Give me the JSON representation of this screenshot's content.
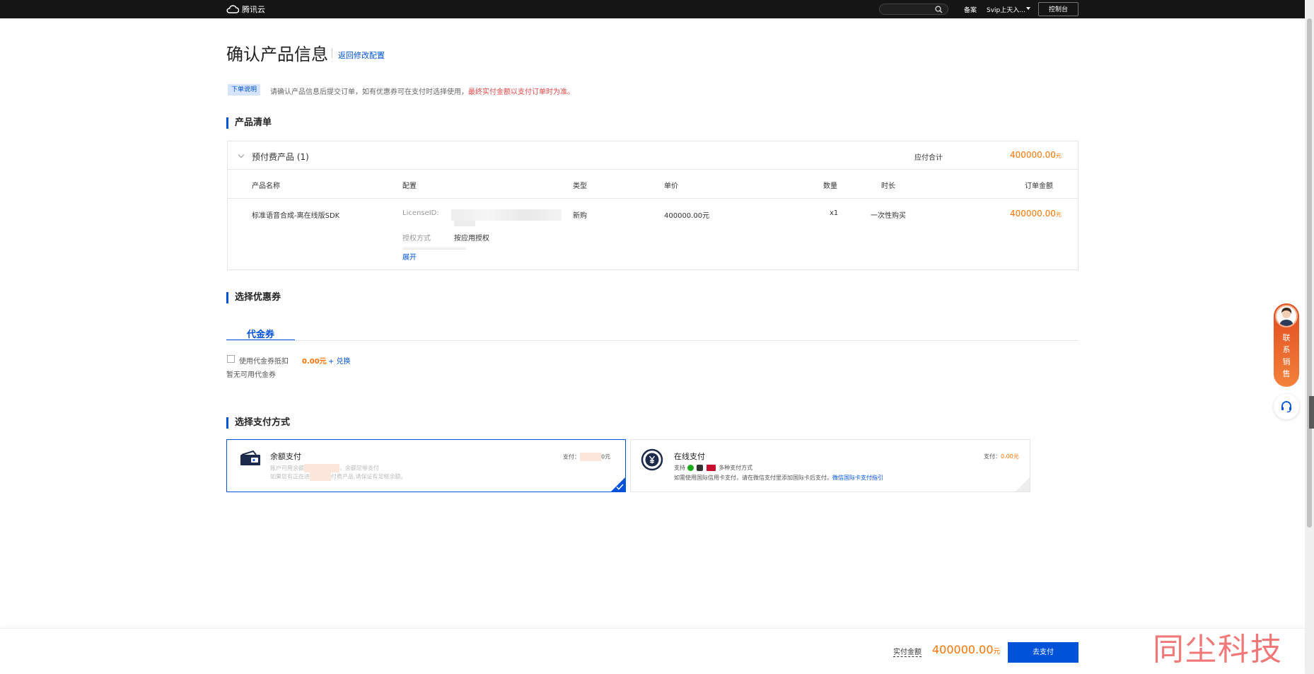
{
  "topbar": {
    "brand": "腾讯云",
    "beian": "备案",
    "user": "Svip上天入...",
    "console": "控制台"
  },
  "header": {
    "title": "确认产品信息",
    "back_link": "返回修改配置"
  },
  "notice": {
    "tag": "下单说明",
    "text": "请确认产品信息后提交订单，如有优惠券可在支付时选择使用，",
    "highlight": "最终实付金额以支付订单时为准。"
  },
  "products": {
    "section_title": "产品清单",
    "group_name": "预付费产品 (1)",
    "group_total_label": "应付合计",
    "group_total": "400000.00",
    "currency": "元",
    "columns": [
      "产品名称",
      "配置",
      "类型",
      "单价",
      "数量",
      "时长",
      "订单金额"
    ],
    "row": {
      "name": "标准语音合成-离在线版SDK",
      "config_key1": "LicenseID:",
      "config_key2": "授权方式",
      "config_val2": "按应用授权",
      "expand": "展开",
      "type": "新购",
      "unit_price": "400000.00元",
      "quantity": "x1",
      "duration": "一次性购买",
      "amount": "400000.00"
    }
  },
  "coupon": {
    "section_title": "选择优惠券",
    "tab": "代金券",
    "checkbox_label": "使用代金券抵扣",
    "amount": "0.00元",
    "exchange": "+ 兑换",
    "empty": "暂无可用代金券"
  },
  "payment": {
    "section_title": "选择支付方式",
    "balance": {
      "title": "余额支付",
      "desc1a": "账户可用余额",
      "desc1b": "，余额足够支付",
      "desc2a": "如果您有正在进",
      "desc2b": "付费产品,请保证有足够余额。",
      "amount_label": "支付：",
      "amount_suffix": "0元"
    },
    "online": {
      "title": "在线支付",
      "methods_label": "支持",
      "methods_more": "多种支付方式",
      "note": "如需使用国际信用卡支付，请在微信支付里添加国际卡后支付。",
      "guide": "微信国际卡支付指引",
      "amount_label": "支付：",
      "amount": "0.00元"
    }
  },
  "side": {
    "sales": [
      "联",
      "系",
      "销",
      "售"
    ]
  },
  "footer": {
    "final_label": "实付金额",
    "final_amount": "400000.00",
    "currency": "元",
    "pay_button": "去支付",
    "watermark": "同尘科技"
  },
  "colors": {
    "primary": "#0052d9",
    "price": "#ff7200",
    "warning": "#e54545"
  }
}
